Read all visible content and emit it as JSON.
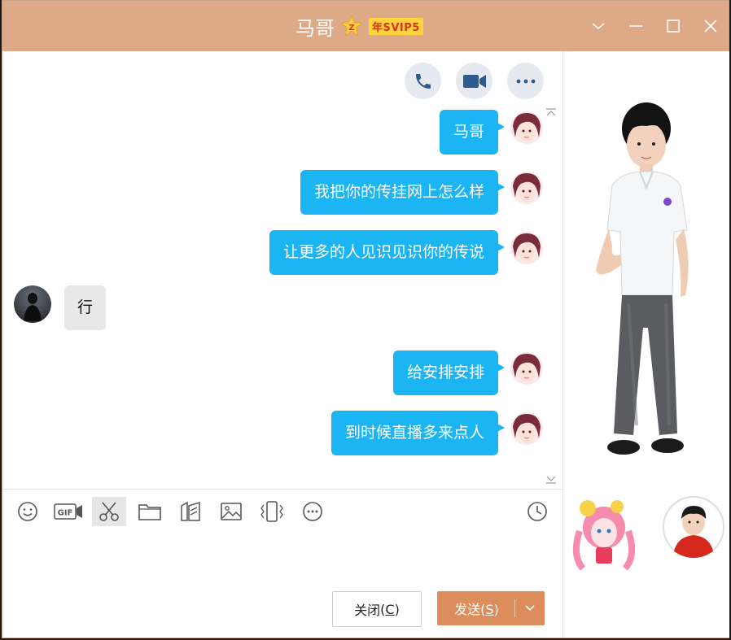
{
  "window": {
    "title": "马哥",
    "vip_badge": "年SVIP5",
    "title_bg": "#dea987"
  },
  "controls": {
    "collapse": "chevron-down-icon",
    "minimize": "minimize-icon",
    "maximize": "maximize-icon",
    "close": "close-icon"
  },
  "chat_actions": [
    "phone-call-icon",
    "video-call-icon",
    "more-icon"
  ],
  "messages": [
    {
      "side": "out",
      "text": "马哥"
    },
    {
      "side": "out",
      "text": "我把你的传挂网上怎么样"
    },
    {
      "side": "out",
      "text": "让更多的人见识见识你的传说"
    },
    {
      "side": "in",
      "text": "行"
    },
    {
      "side": "out",
      "text": "给安排安排"
    },
    {
      "side": "out",
      "text": "到时候直播多来点人"
    }
  ],
  "toolbar": {
    "tools": [
      "emoji-icon",
      "gif-icon",
      "screenshot-scissors-icon",
      "folder-icon",
      "remote-file-icon",
      "image-icon",
      "shake-window-icon",
      "more-tools-icon"
    ],
    "history": "clock-icon"
  },
  "buttons": {
    "close_label": "关闭",
    "close_key": "C",
    "send_label": "发送",
    "send_key": "S"
  },
  "colors": {
    "bubble_out": "#1cb5f4",
    "bubble_in": "#e8e8e8",
    "send_button": "#dc8d5b"
  }
}
